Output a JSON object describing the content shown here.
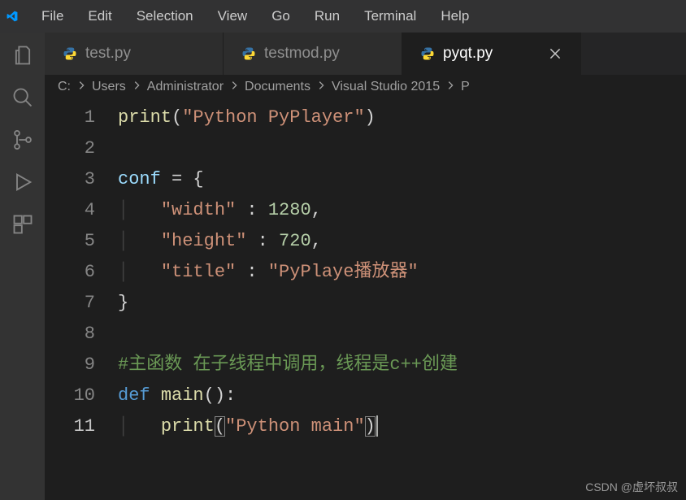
{
  "menu": {
    "items": [
      "File",
      "Edit",
      "Selection",
      "View",
      "Go",
      "Run",
      "Terminal",
      "Help"
    ]
  },
  "tabs": [
    {
      "label": "test.py",
      "active": false
    },
    {
      "label": "testmod.py",
      "active": false
    },
    {
      "label": "pyqt.py",
      "active": true
    }
  ],
  "breadcrumb": {
    "segments": [
      "C:",
      "Users",
      "Administrator",
      "Documents",
      "Visual Studio 2015",
      "P"
    ]
  },
  "editor": {
    "current_line": 11,
    "lines": [
      {
        "n": 1,
        "tokens": [
          [
            "fn",
            "print"
          ],
          [
            "pun",
            "("
          ],
          [
            "str",
            "\"Python PyPlayer\""
          ],
          [
            "pun",
            ")"
          ]
        ]
      },
      {
        "n": 2,
        "tokens": []
      },
      {
        "n": 3,
        "tokens": [
          [
            "var",
            "conf"
          ],
          [
            "pun",
            " = {"
          ]
        ]
      },
      {
        "n": 4,
        "tokens": [
          [
            "guide",
            "    "
          ],
          [
            "str",
            "\"width\""
          ],
          [
            "pun",
            " : "
          ],
          [
            "num",
            "1280"
          ],
          [
            "pun",
            ","
          ]
        ]
      },
      {
        "n": 5,
        "tokens": [
          [
            "guide",
            "    "
          ],
          [
            "str",
            "\"height\""
          ],
          [
            "pun",
            " : "
          ],
          [
            "num",
            "720"
          ],
          [
            "pun",
            ","
          ]
        ]
      },
      {
        "n": 6,
        "tokens": [
          [
            "guide",
            "    "
          ],
          [
            "str",
            "\"title\""
          ],
          [
            "pun",
            " : "
          ],
          [
            "str",
            "\"PyPlaye播放器\""
          ]
        ]
      },
      {
        "n": 7,
        "tokens": [
          [
            "pun",
            "}"
          ]
        ]
      },
      {
        "n": 8,
        "tokens": []
      },
      {
        "n": 9,
        "tokens": [
          [
            "cmt",
            "#主函数 在子线程中调用，线程是c++创建"
          ]
        ]
      },
      {
        "n": 10,
        "tokens": [
          [
            "kw",
            "def "
          ],
          [
            "fn",
            "main"
          ],
          [
            "pun",
            "():"
          ]
        ]
      },
      {
        "n": 11,
        "tokens": [
          [
            "guide",
            "    "
          ],
          [
            "fn",
            "print"
          ],
          [
            "punhl",
            "("
          ],
          [
            "str",
            "\"Python main\""
          ],
          [
            "punhl",
            ")"
          ],
          [
            "cursor",
            ""
          ]
        ]
      }
    ]
  },
  "watermark": "CSDN @虚坏叔叔"
}
